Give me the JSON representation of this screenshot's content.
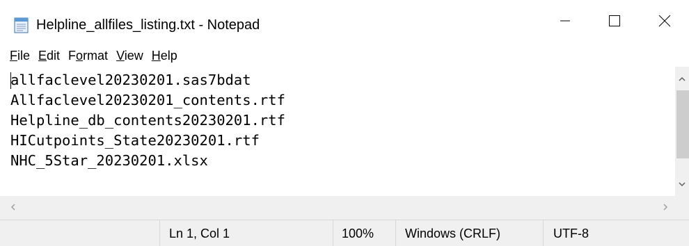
{
  "window": {
    "title": "Helpline_allfiles_listing.txt - Notepad"
  },
  "menu": {
    "items": [
      {
        "accel": "F",
        "rest": "ile"
      },
      {
        "accel": "E",
        "rest": "dit"
      },
      {
        "pre": "F",
        "accel": "o",
        "rest": "rmat"
      },
      {
        "accel": "V",
        "rest": "iew"
      },
      {
        "accel": "H",
        "rest": "elp"
      }
    ]
  },
  "editor": {
    "content": "allfaclevel20230201.sas7bdat\nAllfaclevel20230201_contents.rtf\nHelpline_db_contents20230201.rtf\nHICutpoints_State20230201.rtf\nNHC_5Star_20230201.xlsx"
  },
  "status": {
    "position": "Ln 1, Col 1",
    "zoom": "100%",
    "line_ending": "Windows (CRLF)",
    "encoding": "UTF-8"
  },
  "icons": {
    "app": "notepad-icon",
    "minimize": "minimize-icon",
    "maximize": "maximize-icon",
    "close": "close-icon",
    "scroll_up": "chevron-up-icon",
    "scroll_down": "chevron-down-icon",
    "scroll_left": "chevron-left-icon",
    "scroll_right": "chevron-right-icon"
  }
}
